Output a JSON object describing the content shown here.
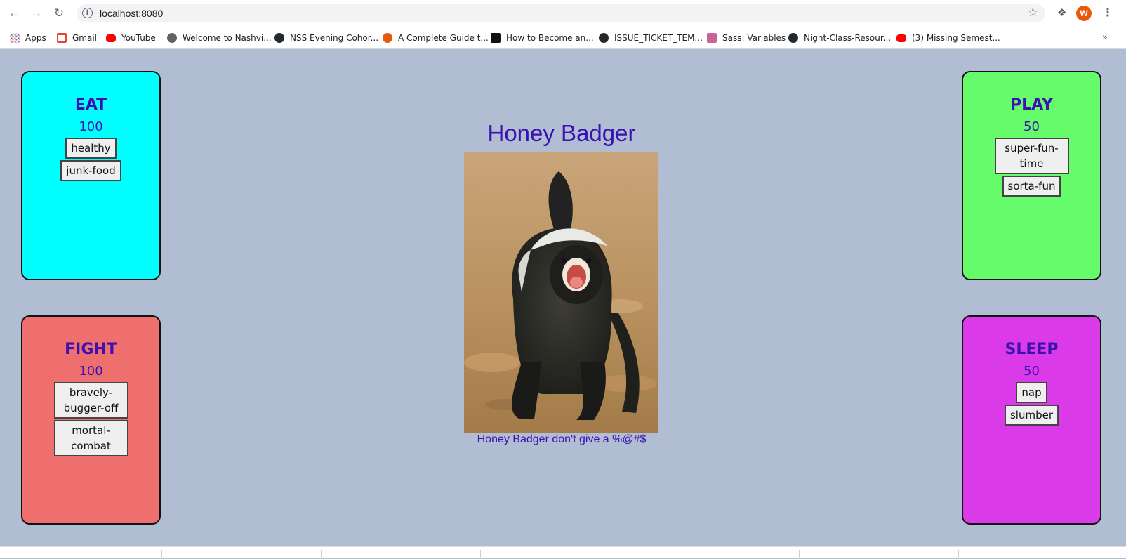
{
  "browser": {
    "url": "localhost:8080",
    "avatar_letter": "W",
    "bookmarks": [
      {
        "label": "Apps",
        "icon": "apps-grid-icon"
      },
      {
        "label": "Gmail",
        "icon": "gmail-icon"
      },
      {
        "label": "YouTube",
        "icon": "youtube-icon"
      },
      {
        "label": "Welcome to Nashvi...",
        "icon": "globe-icon"
      },
      {
        "label": "NSS Evening Cohor...",
        "icon": "github-icon"
      },
      {
        "label": "A Complete Guide t...",
        "icon": "asterisk-icon"
      },
      {
        "label": "How to Become an...",
        "icon": "site-icon"
      },
      {
        "label": "ISSUE_TICKET_TEM...",
        "icon": "github-icon"
      },
      {
        "label": "Sass: Variables",
        "icon": "sass-icon"
      },
      {
        "label": "Night-Class-Resour...",
        "icon": "github-icon"
      },
      {
        "label": "(3) Missing Semest...",
        "icon": "youtube-icon"
      }
    ],
    "more_label": "»"
  },
  "pet": {
    "name": "Honey Badger",
    "caption": "Honey Badger don't give a %@#$"
  },
  "cards": {
    "eat": {
      "title": "EAT",
      "value": "100",
      "color": "#00ffff",
      "buttons": [
        "healthy",
        "junk-food"
      ]
    },
    "play": {
      "title": "PLAY",
      "value": "50",
      "color": "#66fb6a",
      "buttons": [
        "super-fun-\ntime",
        "sorta-fun"
      ]
    },
    "fight": {
      "title": "FIGHT",
      "value": "100",
      "color": "#ef6e6e",
      "buttons": [
        "bravely-\nbugger-off",
        "mortal-\ncombat"
      ]
    },
    "sleep": {
      "title": "SLEEP",
      "value": "50",
      "color": "#da3ae8",
      "buttons": [
        "nap",
        "slumber"
      ]
    }
  },
  "colors": {
    "page_bg": "#b0bdd2",
    "text_accent": "#3a12b0"
  }
}
